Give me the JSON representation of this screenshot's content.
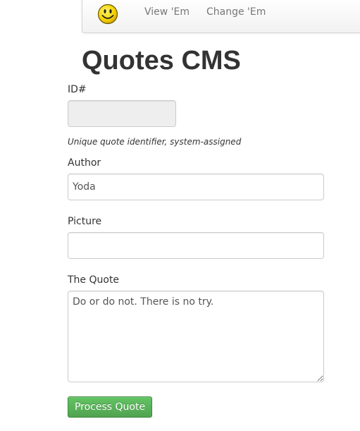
{
  "navbar": {
    "brand_icon": "smiley-face-icon",
    "links": [
      {
        "label": "View 'Em"
      },
      {
        "label": "Change 'Em"
      }
    ]
  },
  "page_title": "Quotes CMS",
  "form": {
    "id_field": {
      "label": "ID#",
      "value": "",
      "help": "Unique quote identifier, system-assigned"
    },
    "author_field": {
      "label": "Author",
      "value": "Yoda"
    },
    "picture_field": {
      "label": "Picture",
      "value": ""
    },
    "quote_field": {
      "label": "The Quote",
      "value": "Do or do not. There is no try."
    },
    "submit_label": "Process Quote"
  },
  "colors": {
    "submit_button": "#5bb75b",
    "navbar_border": "#d4d4d4",
    "readonly_input_bg": "#eeeeee"
  }
}
